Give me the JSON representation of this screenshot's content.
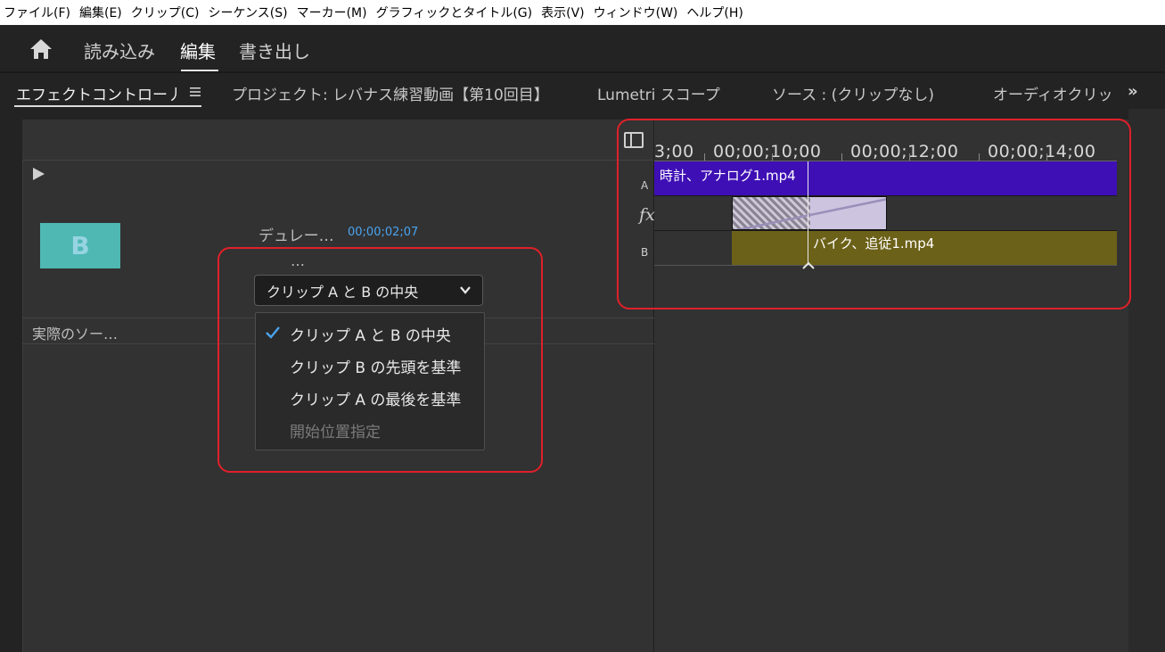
{
  "menu": [
    "ファイル(F)",
    "編集(E)",
    "クリップ(C)",
    "シーケンス(S)",
    "マーカー(M)",
    "グラフィックとタイトル(G)",
    "表示(V)",
    "ウィンドウ(W)",
    "ヘルプ(H)"
  ],
  "workspace": {
    "tabs": [
      "読み込み",
      "編集",
      "書き出し"
    ],
    "active": "編集"
  },
  "panels": {
    "tabs": [
      "エフェクトコントロー丿",
      "プロジェクト: レバナス練習動画【第10回目】",
      "Lumetri スコープ",
      "ソース : (クリップなし)",
      "オーディオクリッ"
    ],
    "overflow_icon": "double-chevron-right-icon"
  },
  "effect_controls": {
    "thumbnail_letter": "B",
    "duration_label": "デュレー…",
    "duration_value": "00;00;02;07",
    "ellipsis": "…",
    "alignment_selected": "クリップ A と B の中央",
    "actual_source_label": "実際のソー…",
    "alignment_options": [
      {
        "label": "クリップ A と B の中央",
        "checked": true,
        "disabled": false
      },
      {
        "label": "クリップ B の先頭を基準",
        "checked": false,
        "disabled": false
      },
      {
        "label": "クリップ A の最後を基準",
        "checked": false,
        "disabled": false
      },
      {
        "label": "開始位置指定",
        "checked": false,
        "disabled": true
      }
    ]
  },
  "timeline": {
    "ruler": [
      "3;00",
      "00;00;10;00",
      "00;00;12;00",
      "00;00;14;00"
    ],
    "track_labels": {
      "a": "A",
      "fx": "fx",
      "b": "B"
    },
    "clip_a": "時計、アナログ1.mp4",
    "clip_b": "バイク、追従1.mp4"
  },
  "colors": {
    "clip_a": "#3e0fb4",
    "clip_b": "#6c6118",
    "accent": "#4aa3f0",
    "highlight": "#e0202a"
  }
}
